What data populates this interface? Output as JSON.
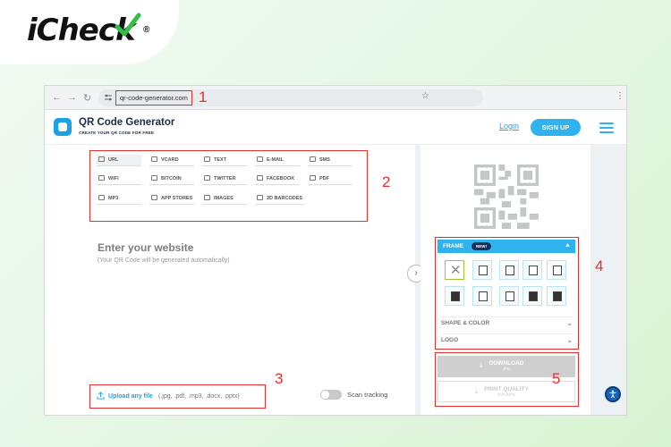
{
  "brand_logo": {
    "text": "iCheck",
    "mark": "®"
  },
  "browser": {
    "url": "qr-code-generator.com",
    "icons": [
      "back-icon",
      "forward-icon",
      "reload-icon",
      "site-settings-icon",
      "bookmark-star-icon",
      "more-menu-icon"
    ]
  },
  "annotations": [
    "1",
    "2",
    "3",
    "4",
    "5"
  ],
  "header": {
    "title": "QR Code Generator",
    "subtitle": "CREATE YOUR QR CODE FOR FREE",
    "login": "Login",
    "signup": "SIGN UP"
  },
  "qr_types": [
    {
      "label": "URL",
      "active": true
    },
    {
      "label": "VCARD"
    },
    {
      "label": "TEXT"
    },
    {
      "label": "E-MAIL"
    },
    {
      "label": "SMS"
    },
    {
      "label": "WIFI"
    },
    {
      "label": "BITCOIN"
    },
    {
      "label": "TWITTER"
    },
    {
      "label": "FACEBOOK"
    },
    {
      "label": "PDF"
    },
    {
      "label": "MP3"
    },
    {
      "label": "APP STORES"
    },
    {
      "label": "IMAGES"
    },
    {
      "label": "2D BARCODES"
    }
  ],
  "main": {
    "input_title": "Enter your website",
    "input_hint": "(Your QR Code will be generated automatically)",
    "upload_link": "Upload any file",
    "upload_types": "(.jpg, .pdf, .mp3, .docx, .pptx)",
    "scan_tracking_label": "Scan tracking",
    "toggle_state": "off"
  },
  "sidebar": {
    "frame_title": "FRAME",
    "new_badge": "NEW!",
    "shape_color": "SHAPE & COLOR",
    "logo": "LOGO",
    "download": "DOWNLOAD",
    "download_sub": "JPG",
    "print_quality": "PRINT QUALITY",
    "print_sub": "SVG/EPS"
  },
  "colors": {
    "accent": "#2eb3ef",
    "annotation": "#e03030",
    "brand_dark": "#16305c"
  }
}
